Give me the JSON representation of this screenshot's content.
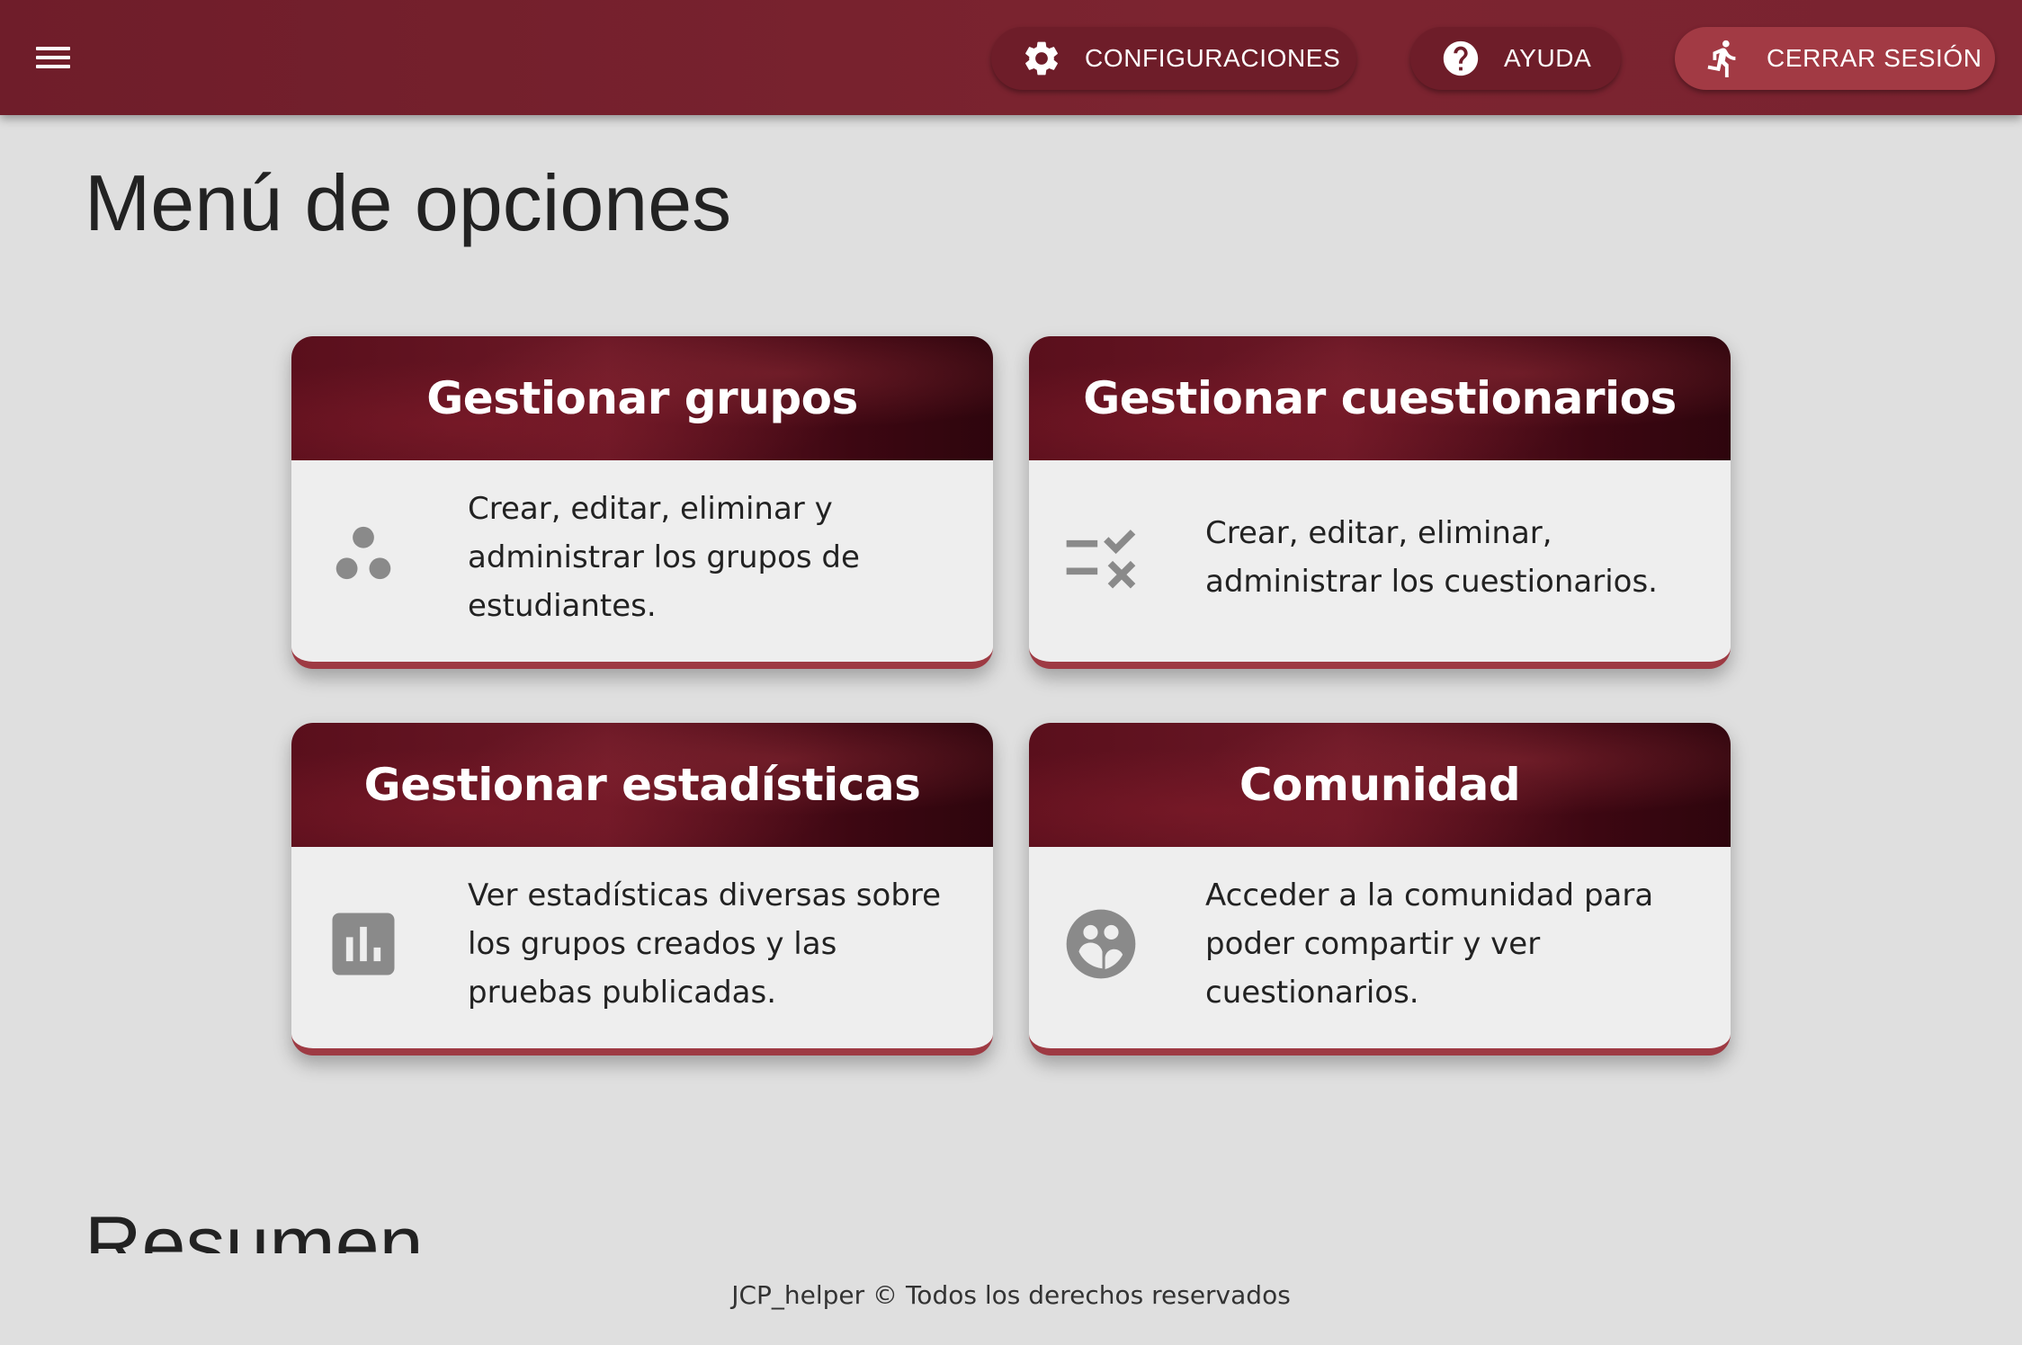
{
  "topbar": {
    "menu_icon": "hamburger-menu-icon",
    "buttons": {
      "config": {
        "label": "CONFIGURACIONES",
        "icon": "gear-icon"
      },
      "help": {
        "label": "AYUDA",
        "icon": "help-circle-icon"
      },
      "logout": {
        "label": "CERRAR SESIÓN",
        "icon": "running-person-icon"
      }
    }
  },
  "page": {
    "title": "Menú de opciones",
    "section_summary": "Resumen"
  },
  "cards": [
    {
      "title": "Gestionar grupos",
      "description": "Crear, editar, eliminar y administrar los grupos de estudiantes.",
      "icon": "group-workspaces-icon"
    },
    {
      "title": "Gestionar cuestionarios",
      "description": "Crear, editar, eliminar, administrar los cuestionarios.",
      "icon": "rule-checklist-icon"
    },
    {
      "title": "Gestionar estadísticas",
      "description": "Ver estadísticas diversas sobre los grupos creados y las pruebas publicadas.",
      "icon": "bar-chart-icon"
    },
    {
      "title": "Comunidad",
      "description": "Acceder a la comunidad para poder compartir y ver cuestionarios.",
      "icon": "community-people-icon"
    }
  ],
  "footer": {
    "text": "JCP_helper © Todos los derechos reservados"
  },
  "colors": {
    "topbar": "#7a2330",
    "logout_button": "#a23a44",
    "card_accent": "#9e3a43",
    "background": "#dfdfdf",
    "icon_gray": "#8a8a8a"
  }
}
